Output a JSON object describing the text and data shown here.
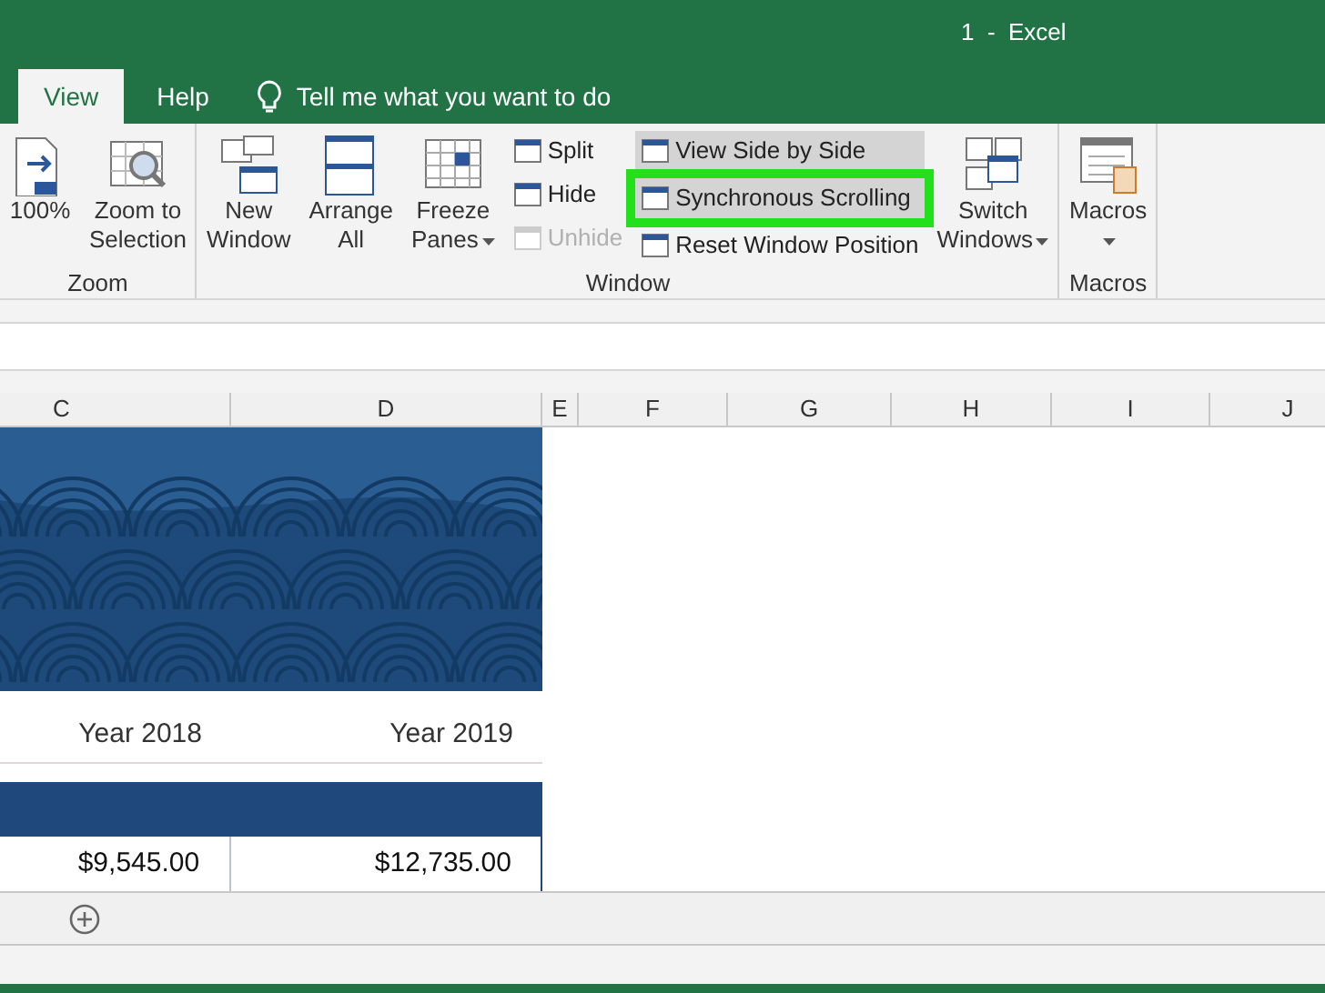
{
  "window": {
    "title": "1  -  Excel"
  },
  "tabs": [
    {
      "label": "View",
      "selected": true
    },
    {
      "label": "Help",
      "selected": false
    }
  ],
  "tell_me": {
    "placeholder": "Tell me what you want to do"
  },
  "ribbon": {
    "groups": [
      {
        "label": "Zoom",
        "items": [
          {
            "kind": "large",
            "lines": [
              "100%"
            ],
            "dropdown": false
          },
          {
            "kind": "large",
            "lines": [
              "Zoom to",
              "Selection"
            ],
            "dropdown": false
          }
        ]
      },
      {
        "label": "Window",
        "items": [
          {
            "kind": "large",
            "lines": [
              "New",
              "Window"
            ],
            "dropdown": false
          },
          {
            "kind": "large",
            "lines": [
              "Arrange",
              "All"
            ],
            "dropdown": false
          },
          {
            "kind": "large",
            "lines": [
              "Freeze",
              "Panes"
            ],
            "dropdown": true
          },
          {
            "kind": "stack",
            "items": [
              {
                "label": "Split",
                "on": false,
                "disabled": false,
                "highlighted": false
              },
              {
                "label": "Hide",
                "on": false,
                "disabled": false,
                "highlighted": false
              },
              {
                "label": "Unhide",
                "on": false,
                "disabled": true,
                "highlighted": false
              }
            ]
          },
          {
            "kind": "stack",
            "items": [
              {
                "label": "View Side by Side",
                "on": true,
                "disabled": false,
                "highlighted": false
              },
              {
                "label": "Synchronous Scrolling",
                "on": true,
                "disabled": false,
                "highlighted": true
              },
              {
                "label": "Reset Window Position",
                "on": false,
                "disabled": false,
                "highlighted": false
              }
            ]
          },
          {
            "kind": "large",
            "lines": [
              "Switch",
              "Windows"
            ],
            "dropdown": true
          }
        ]
      },
      {
        "label": "Macros",
        "items": [
          {
            "kind": "large",
            "lines": [
              "Macros"
            ],
            "dropdown": true
          }
        ]
      }
    ]
  },
  "columns": [
    "C",
    "D",
    "E",
    "F",
    "G",
    "H",
    "I",
    "J"
  ],
  "table": {
    "header_row": [
      "Year 2018",
      "Year 2019"
    ],
    "value_row": [
      "$9,545.00",
      "$12,735.00"
    ]
  }
}
